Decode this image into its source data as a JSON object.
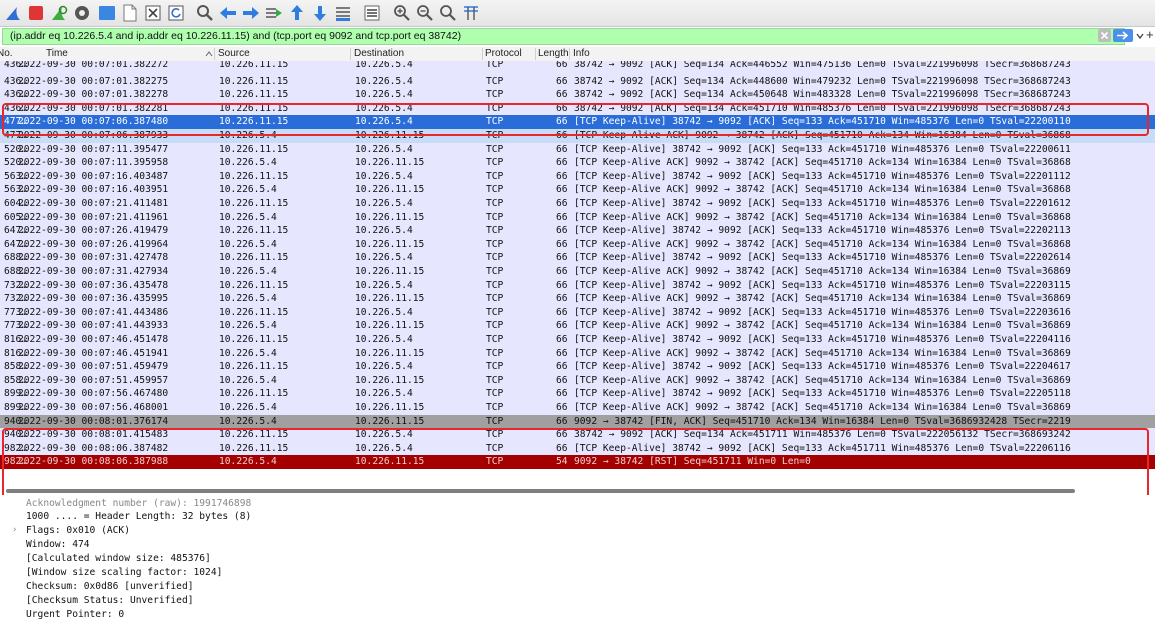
{
  "colors": {
    "filter_bg": "#afffaf",
    "tcp_row": "#e7e6ff",
    "selected_row": "#2a6cd8",
    "related_row": "#c9dcf7",
    "fin_row": "#a0a0a0",
    "rst_row": "#a40000",
    "highlight_box": "#e8262b"
  },
  "toolbar": {
    "icons": [
      "shark-fin-start-icon",
      "stop-capture-icon",
      "restart-capture-icon",
      "capture-options-icon",
      "open-file-icon",
      "save-file-icon",
      "close-file-icon",
      "reload-file-icon",
      "find-packet-icon",
      "go-back-icon",
      "go-forward-icon",
      "go-to-packet-icon",
      "go-first-icon",
      "go-last-icon",
      "auto-scroll-icon",
      "colorize-icon",
      "zoom-in-icon",
      "zoom-out-icon",
      "normal-size-icon",
      "resize-columns-icon"
    ]
  },
  "filter": {
    "text": "(ip.addr eq 10.226.5.4 and ip.addr eq 10.226.11.15) and (tcp.port eq 9092 and tcp.port eq 38742)",
    "plus": "+"
  },
  "columns": {
    "no": "No.",
    "time": "Time",
    "source": "Source",
    "destination": "Destination",
    "protocol": "Protocol",
    "length": "Length",
    "info": "Info"
  },
  "packets": [
    {
      "no": "436…",
      "time": "2022-09-30 00:07:01.382272",
      "src": "10.226.11.15",
      "dst": "10.226.5.4",
      "proto": "TCP",
      "len": "66",
      "info": "38742 → 9092 [ACK] Seq=134 Ack=446552 Win=475136 Len=0 TSval=221996098 TSecr=368687243",
      "style": "cut"
    },
    {
      "no": "436…",
      "time": "2022-09-30 00:07:01.382275",
      "src": "10.226.11.15",
      "dst": "10.226.5.4",
      "proto": "TCP",
      "len": "66",
      "info": "38742 → 9092 [ACK] Seq=134 Ack=448600 Win=479232 Len=0 TSval=221996098 TSecr=368687243",
      "style": "tcp"
    },
    {
      "no": "436…",
      "time": "2022-09-30 00:07:01.382278",
      "src": "10.226.11.15",
      "dst": "10.226.5.4",
      "proto": "TCP",
      "len": "66",
      "info": "38742 → 9092 [ACK] Seq=134 Ack=450648 Win=483328 Len=0 TSval=221996098 TSecr=368687243",
      "style": "tcp"
    },
    {
      "no": "436…",
      "time": "2022-09-30 00:07:01.382281",
      "src": "10.226.11.15",
      "dst": "10.226.5.4",
      "proto": "TCP",
      "len": "66",
      "info": "38742 → 9092 [ACK] Seq=134 Ack=451710 Win=485376 Len=0 TSval=221996098 TSecr=368687243",
      "style": "strike"
    },
    {
      "no": "477…",
      "time": "2022-09-30 00:07:06.387480",
      "src": "10.226.11.15",
      "dst": "10.226.5.4",
      "proto": "TCP",
      "len": "66",
      "info": "[TCP Keep-Alive] 38742 → 9092 [ACK] Seq=133 Ack=451710 Win=485376 Len=0 TSval=22200110",
      "style": "selected"
    },
    {
      "no": "477…",
      "time": "2022-09-30 00:07:06.387933",
      "src": "10.226.5.4",
      "dst": "10.226.11.15",
      "proto": "TCP",
      "len": "66",
      "info": "[TCP Keep-Alive ACK] 9092 → 38742 [ACK] Seq=451710 Ack=134 Win=16384 Len=0 TSval=36868",
      "style": "related"
    },
    {
      "no": "520…",
      "time": "2022-09-30 00:07:11.395477",
      "src": "10.226.11.15",
      "dst": "10.226.5.4",
      "proto": "TCP",
      "len": "66",
      "info": "[TCP Keep-Alive] 38742 → 9092 [ACK] Seq=133 Ack=451710 Win=485376 Len=0 TSval=22200611",
      "style": "tcp"
    },
    {
      "no": "520…",
      "time": "2022-09-30 00:07:11.395958",
      "src": "10.226.5.4",
      "dst": "10.226.11.15",
      "proto": "TCP",
      "len": "66",
      "info": "[TCP Keep-Alive ACK] 9092 → 38742 [ACK] Seq=451710 Ack=134 Win=16384 Len=0 TSval=36868",
      "style": "tcp"
    },
    {
      "no": "563…",
      "time": "2022-09-30 00:07:16.403487",
      "src": "10.226.11.15",
      "dst": "10.226.5.4",
      "proto": "TCP",
      "len": "66",
      "info": "[TCP Keep-Alive] 38742 → 9092 [ACK] Seq=133 Ack=451710 Win=485376 Len=0 TSval=22201112",
      "style": "tcp"
    },
    {
      "no": "563…",
      "time": "2022-09-30 00:07:16.403951",
      "src": "10.226.5.4",
      "dst": "10.226.11.15",
      "proto": "TCP",
      "len": "66",
      "info": "[TCP Keep-Alive ACK] 9092 → 38742 [ACK] Seq=451710 Ack=134 Win=16384 Len=0 TSval=36868",
      "style": "tcp"
    },
    {
      "no": "604…",
      "time": "2022-09-30 00:07:21.411481",
      "src": "10.226.11.15",
      "dst": "10.226.5.4",
      "proto": "TCP",
      "len": "66",
      "info": "[TCP Keep-Alive] 38742 → 9092 [ACK] Seq=133 Ack=451710 Win=485376 Len=0 TSval=22201612",
      "style": "tcp"
    },
    {
      "no": "605…",
      "time": "2022-09-30 00:07:21.411961",
      "src": "10.226.5.4",
      "dst": "10.226.11.15",
      "proto": "TCP",
      "len": "66",
      "info": "[TCP Keep-Alive ACK] 9092 → 38742 [ACK] Seq=451710 Ack=134 Win=16384 Len=0 TSval=36868",
      "style": "tcp"
    },
    {
      "no": "647…",
      "time": "2022-09-30 00:07:26.419479",
      "src": "10.226.11.15",
      "dst": "10.226.5.4",
      "proto": "TCP",
      "len": "66",
      "info": "[TCP Keep-Alive] 38742 → 9092 [ACK] Seq=133 Ack=451710 Win=485376 Len=0 TSval=22202113",
      "style": "tcp"
    },
    {
      "no": "647…",
      "time": "2022-09-30 00:07:26.419964",
      "src": "10.226.5.4",
      "dst": "10.226.11.15",
      "proto": "TCP",
      "len": "66",
      "info": "[TCP Keep-Alive ACK] 9092 → 38742 [ACK] Seq=451710 Ack=134 Win=16384 Len=0 TSval=36868",
      "style": "tcp"
    },
    {
      "no": "688…",
      "time": "2022-09-30 00:07:31.427478",
      "src": "10.226.11.15",
      "dst": "10.226.5.4",
      "proto": "TCP",
      "len": "66",
      "info": "[TCP Keep-Alive] 38742 → 9092 [ACK] Seq=133 Ack=451710 Win=485376 Len=0 TSval=22202614",
      "style": "tcp"
    },
    {
      "no": "688…",
      "time": "2022-09-30 00:07:31.427934",
      "src": "10.226.5.4",
      "dst": "10.226.11.15",
      "proto": "TCP",
      "len": "66",
      "info": "[TCP Keep-Alive ACK] 9092 → 38742 [ACK] Seq=451710 Ack=134 Win=16384 Len=0 TSval=36869",
      "style": "tcp"
    },
    {
      "no": "732…",
      "time": "2022-09-30 00:07:36.435478",
      "src": "10.226.11.15",
      "dst": "10.226.5.4",
      "proto": "TCP",
      "len": "66",
      "info": "[TCP Keep-Alive] 38742 → 9092 [ACK] Seq=133 Ack=451710 Win=485376 Len=0 TSval=22203115",
      "style": "tcp"
    },
    {
      "no": "732…",
      "time": "2022-09-30 00:07:36.435995",
      "src": "10.226.5.4",
      "dst": "10.226.11.15",
      "proto": "TCP",
      "len": "66",
      "info": "[TCP Keep-Alive ACK] 9092 → 38742 [ACK] Seq=451710 Ack=134 Win=16384 Len=0 TSval=36869",
      "style": "tcp"
    },
    {
      "no": "773…",
      "time": "2022-09-30 00:07:41.443486",
      "src": "10.226.11.15",
      "dst": "10.226.5.4",
      "proto": "TCP",
      "len": "66",
      "info": "[TCP Keep-Alive] 38742 → 9092 [ACK] Seq=133 Ack=451710 Win=485376 Len=0 TSval=22203616",
      "style": "tcp"
    },
    {
      "no": "773…",
      "time": "2022-09-30 00:07:41.443933",
      "src": "10.226.5.4",
      "dst": "10.226.11.15",
      "proto": "TCP",
      "len": "66",
      "info": "[TCP Keep-Alive ACK] 9092 → 38742 [ACK] Seq=451710 Ack=134 Win=16384 Len=0 TSval=36869",
      "style": "tcp"
    },
    {
      "no": "816…",
      "time": "2022-09-30 00:07:46.451478",
      "src": "10.226.11.15",
      "dst": "10.226.5.4",
      "proto": "TCP",
      "len": "66",
      "info": "[TCP Keep-Alive] 38742 → 9092 [ACK] Seq=133 Ack=451710 Win=485376 Len=0 TSval=22204116",
      "style": "tcp"
    },
    {
      "no": "816…",
      "time": "2022-09-30 00:07:46.451941",
      "src": "10.226.5.4",
      "dst": "10.226.11.15",
      "proto": "TCP",
      "len": "66",
      "info": "[TCP Keep-Alive ACK] 9092 → 38742 [ACK] Seq=451710 Ack=134 Win=16384 Len=0 TSval=36869",
      "style": "tcp"
    },
    {
      "no": "858…",
      "time": "2022-09-30 00:07:51.459479",
      "src": "10.226.11.15",
      "dst": "10.226.5.4",
      "proto": "TCP",
      "len": "66",
      "info": "[TCP Keep-Alive] 38742 → 9092 [ACK] Seq=133 Ack=451710 Win=485376 Len=0 TSval=22204617",
      "style": "tcp"
    },
    {
      "no": "858…",
      "time": "2022-09-30 00:07:51.459957",
      "src": "10.226.5.4",
      "dst": "10.226.11.15",
      "proto": "TCP",
      "len": "66",
      "info": "[TCP Keep-Alive ACK] 9092 → 38742 [ACK] Seq=451710 Ack=134 Win=16384 Len=0 TSval=36869",
      "style": "tcp"
    },
    {
      "no": "899…",
      "time": "2022-09-30 00:07:56.467480",
      "src": "10.226.11.15",
      "dst": "10.226.5.4",
      "proto": "TCP",
      "len": "66",
      "info": "[TCP Keep-Alive] 38742 → 9092 [ACK] Seq=133 Ack=451710 Win=485376 Len=0 TSval=22205118",
      "style": "tcp"
    },
    {
      "no": "899…",
      "time": "2022-09-30 00:07:56.468001",
      "src": "10.226.5.4",
      "dst": "10.226.11.15",
      "proto": "TCP",
      "len": "66",
      "info": "[TCP Keep-Alive ACK] 9092 → 38742 [ACK] Seq=451710 Ack=134 Win=16384 Len=0 TSval=36869",
      "style": "strike"
    },
    {
      "no": "940…",
      "time": "2022-09-30 00:08:01.376174",
      "src": "10.226.5.4",
      "dst": "10.226.11.15",
      "proto": "TCP",
      "len": "66",
      "info": "9092 → 38742 [FIN, ACK] Seq=451710 Ack=134 Win=16384 Len=0 TSval=3686932428 TSecr=2219",
      "style": "fin"
    },
    {
      "no": "940…",
      "time": "2022-09-30 00:08:01.415483",
      "src": "10.226.11.15",
      "dst": "10.226.5.4",
      "proto": "TCP",
      "len": "66",
      "info": "38742 → 9092 [ACK] Seq=134 Ack=451711 Win=485376 Len=0 TSval=222056132 TSecr=368693242",
      "style": "tcp"
    },
    {
      "no": "982…",
      "time": "2022-09-30 00:08:06.387482",
      "src": "10.226.11.15",
      "dst": "10.226.5.4",
      "proto": "TCP",
      "len": "66",
      "info": "[TCP Keep-Alive] 38742 → 9092 [ACK] Seq=133 Ack=451711 Win=485376 Len=0 TSval=22206116",
      "style": "tcp"
    },
    {
      "no": "982…",
      "time": "2022-09-30 00:08:06.387988",
      "src": "10.226.5.4",
      "dst": "10.226.11.15",
      "proto": "TCP",
      "len": "54",
      "info": "9092 → 38742 [RST] Seq=451711 Win=0 Len=0",
      "style": "rst"
    }
  ],
  "details": [
    "Acknowledgment number (raw): 1991746898",
    "1000 .... = Header Length: 32 bytes (8)",
    "Flags: 0x010 (ACK)",
    "Window: 474",
    "[Calculated window size: 485376]",
    "[Window size scaling factor: 1024]",
    "Checksum: 0x0d86 [unverified]",
    "[Checksum Status: Unverified]",
    "Urgent Pointer: 0"
  ]
}
